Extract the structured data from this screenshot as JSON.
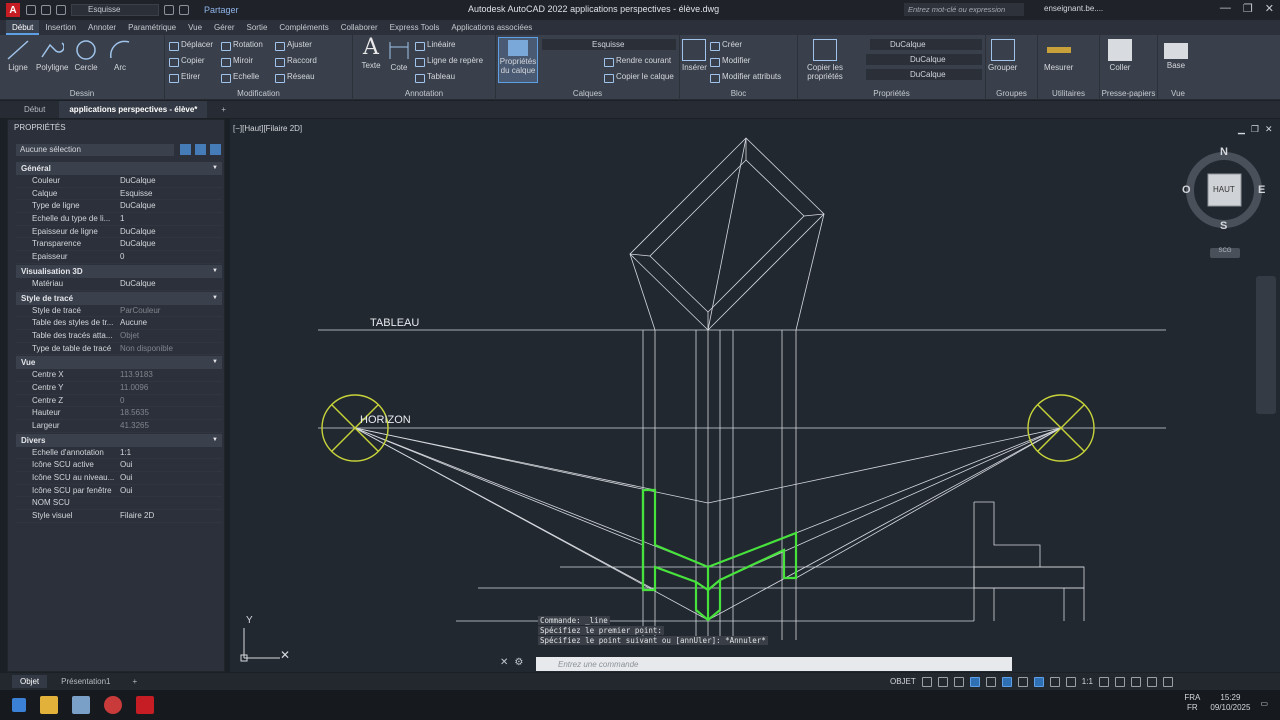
{
  "titlebar": {
    "app_title": "Autodesk AutoCAD 2022    applications perspectives - élève.dwg",
    "layer_quick": "Esquisse",
    "share": "Partager",
    "search_placeholder": "Entrez mot-clé ou expression",
    "user": "enseignant.be...."
  },
  "ribbon_tabs": [
    "Début",
    "Insertion",
    "Annoter",
    "Paramétrique",
    "Vue",
    "Gérer",
    "Sortie",
    "Compléments",
    "Collaborer",
    "Express Tools",
    "Applications associées"
  ],
  "ribbon": {
    "dessin": {
      "title": "Dessin",
      "ligne": "Ligne",
      "polyligne": "Polyligne",
      "cercle": "Cercle",
      "arc": "Arc"
    },
    "modification": {
      "title": "Modification",
      "deplacer": "Déplacer",
      "rotation": "Rotation",
      "ajuster": "Ajuster",
      "copier": "Copier",
      "miroir": "Miroir",
      "raccord": "Raccord",
      "etirer": "Etirer",
      "echelle": "Echelle",
      "reseau": "Réseau"
    },
    "annotation": {
      "title": "Annotation",
      "texte": "Texte",
      "cote": "Cote",
      "lineaire": "Linéaire",
      "ligne_repere": "Ligne de repère",
      "tableau": "Tableau"
    },
    "calques": {
      "title": "Calques",
      "proprietes": "Propriétés du calque",
      "current": "Esquisse",
      "rendre_courant": "Rendre courant",
      "copier_calque": "Copier le calque"
    },
    "bloc": {
      "title": "Bloc",
      "inserer": "Insérer",
      "creer": "Créer",
      "modifier": "Modifier",
      "modifier_attributs": "Modifier attributs"
    },
    "proprietes": {
      "title": "Propriétés",
      "copier": "Copier les propriétés",
      "couleur": "DuCalque",
      "type": "DuCalque",
      "epaisseur": "DuCalque"
    },
    "groupes": {
      "title": "Groupes",
      "grouper": "Grouper"
    },
    "utilitaires": {
      "title": "Utilitaires",
      "mesurer": "Mesurer"
    },
    "presse_papiers": {
      "title": "Presse-papiers",
      "coller": "Coller"
    },
    "vue": {
      "title": "Vue",
      "base": "Base"
    }
  },
  "doc_tabs": [
    "Début",
    "applications perspectives - élève*"
  ],
  "properties": {
    "header": "PROPRIÉTÉS",
    "selection": "Aucune sélection",
    "sections": [
      {
        "title": "Général",
        "rows": [
          [
            "Couleur",
            "DuCalque"
          ],
          [
            "Calque",
            "Esquisse"
          ],
          [
            "Type de ligne",
            "DuCalque"
          ],
          [
            "Echelle du type de li...",
            "1"
          ],
          [
            "Epaisseur de ligne",
            "DuCalque"
          ],
          [
            "Transparence",
            "DuCalque"
          ],
          [
            "Epaisseur",
            "0"
          ]
        ]
      },
      {
        "title": "Visualisation 3D",
        "rows": [
          [
            "Matériau",
            "DuCalque"
          ]
        ]
      },
      {
        "title": "Style de tracé",
        "rows": [
          [
            "Style de tracé",
            "ParCouleur"
          ],
          [
            "Table des styles de tr...",
            "Aucune"
          ],
          [
            "Table des tracés atta...",
            "Objet"
          ],
          [
            "Type de table de tracé",
            "Non disponible"
          ]
        ]
      },
      {
        "title": "Vue",
        "rows": [
          [
            "Centre X",
            "113.9183"
          ],
          [
            "Centre Y",
            "11.0096"
          ],
          [
            "Centre Z",
            "0"
          ],
          [
            "Hauteur",
            "18.5635"
          ],
          [
            "Largeur",
            "41.3265"
          ]
        ]
      },
      {
        "title": "Divers",
        "rows": [
          [
            "Echelle d'annotation",
            "1:1"
          ],
          [
            "Icône SCU active",
            "Oui"
          ],
          [
            "Icône SCU au niveau...",
            "Oui"
          ],
          [
            "Icône SCU par fenêtre",
            "Oui"
          ],
          [
            "NOM SCU",
            ""
          ],
          [
            "Style visuel",
            "Filaire 2D"
          ]
        ]
      }
    ]
  },
  "viewport_label": "[−][Haut][Filaire 2D]",
  "drawing": {
    "tableau": "TABLEAU",
    "horizon": "HORIZON"
  },
  "viewcube": {
    "face": "HAUT",
    "n": "N",
    "s": "S",
    "e": "E",
    "o": "O",
    "scu": "SCG"
  },
  "command": {
    "history": [
      "Commande: _line",
      "Spécifiez le premier point:",
      "Spécifiez le point suivant ou [annUler]: *Annuler*"
    ],
    "placeholder": "Entrez une commande"
  },
  "layout_tabs": [
    "Objet",
    "Présentation1"
  ],
  "status": {
    "space": "OBJET",
    "scale": "1:1"
  },
  "tray": {
    "lang1": "FRA",
    "lang2": "FR",
    "time": "15:29",
    "date": "09/10/2025"
  },
  "colors": {
    "accent": "#5ea0e6",
    "green": "#48e23c",
    "horizon_circle": "#c8d43a"
  }
}
